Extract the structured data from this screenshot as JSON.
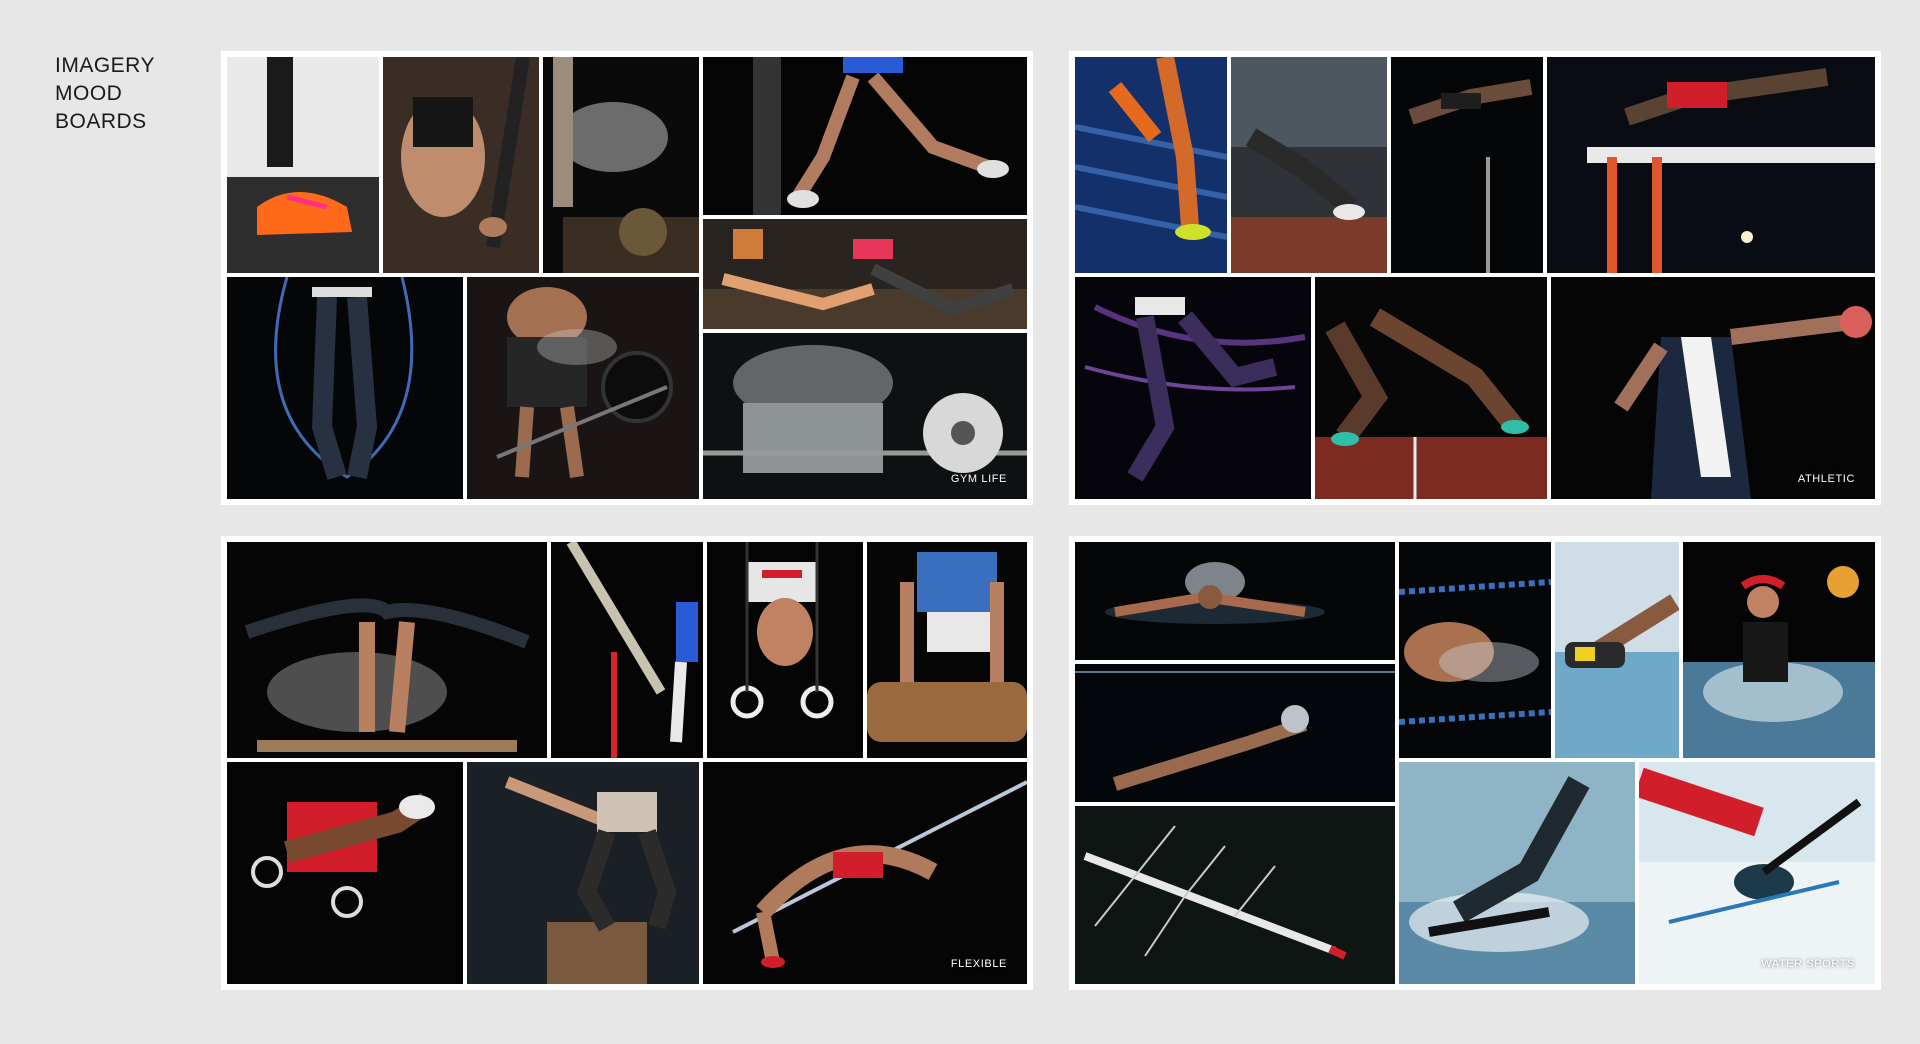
{
  "page": {
    "title_lines": [
      "IMAGERY",
      "MOOD",
      "BOARDS"
    ]
  },
  "boards": [
    {
      "id": "gym",
      "label": "GYM LIFE",
      "photo_count": 9
    },
    {
      "id": "athletic",
      "label": "ATHLETIC",
      "photo_count": 7
    },
    {
      "id": "flexible",
      "label": "FLEXIBLE",
      "photo_count": 7
    },
    {
      "id": "water",
      "label": "WATER SPORTS",
      "photo_count": 8
    }
  ],
  "colors": {
    "background": "#e7e7e7",
    "board_frame": "#ffffff",
    "photo_dark": "#050505",
    "accent_orange": "#ff6a1a",
    "accent_red": "#d8141e",
    "accent_blue": "#2a5bd7",
    "water_blue": "#6fa8c8"
  }
}
